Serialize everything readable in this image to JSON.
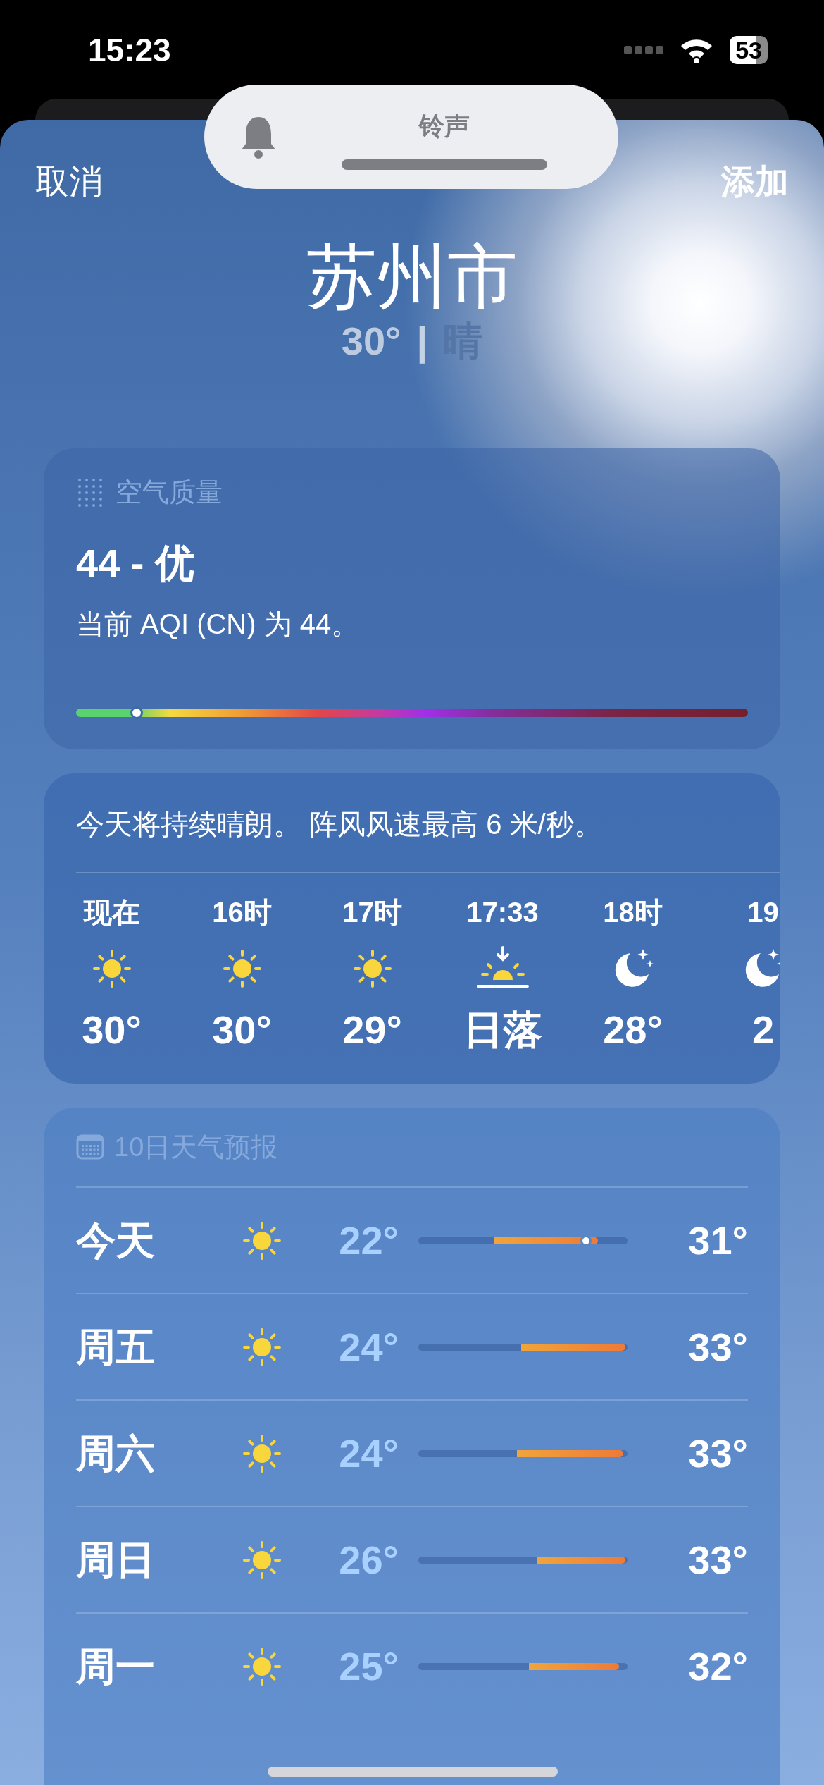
{
  "status_bar": {
    "time": "15:23",
    "battery": "53"
  },
  "ringer_banner": {
    "title": "铃声"
  },
  "nav": {
    "cancel": "取消",
    "add": "添加"
  },
  "location": {
    "city": "苏州市",
    "temperature": "30°",
    "separator": "|",
    "condition": "晴"
  },
  "air_quality": {
    "title": "空气质量",
    "value": "44 - 优",
    "description": "当前 AQI (CN) 为 44。",
    "level": 0.09
  },
  "hourly": {
    "summary": "今天将持续晴朗。 阵风风速最高 6 米/秒。",
    "hours": [
      {
        "label": "现在",
        "kind": "sun",
        "temp": "30°"
      },
      {
        "label": "16时",
        "kind": "sun",
        "temp": "30°"
      },
      {
        "label": "17时",
        "kind": "sun",
        "temp": "29°"
      },
      {
        "label": "17:33",
        "kind": "sunset",
        "temp": "日落"
      },
      {
        "label": "18时",
        "kind": "moon",
        "temp": "28°"
      },
      {
        "label": "19",
        "kind": "moon",
        "temp": "2"
      }
    ]
  },
  "forecast": {
    "title": "10日天气预报",
    "days": [
      {
        "day": "今天",
        "kind": "sun",
        "low": "22°",
        "high": "31°",
        "range": {
          "level": 0.86
        },
        "current": {
          "level": 0.8
        }
      },
      {
        "day": "周五",
        "kind": "sun",
        "low": "24°",
        "high": "33°",
        "range": {
          "level": 0.99
        }
      },
      {
        "day": "周六",
        "kind": "sun",
        "low": "24°",
        "high": "33°",
        "range": {
          "level": 0.98
        }
      },
      {
        "day": "周日",
        "kind": "sun",
        "low": "26°",
        "high": "33°",
        "range": {
          "level": 0.99
        }
      },
      {
        "day": "周一",
        "kind": "sun",
        "low": "25°",
        "high": "32°",
        "range": {
          "level": 0.96
        }
      }
    ]
  }
}
